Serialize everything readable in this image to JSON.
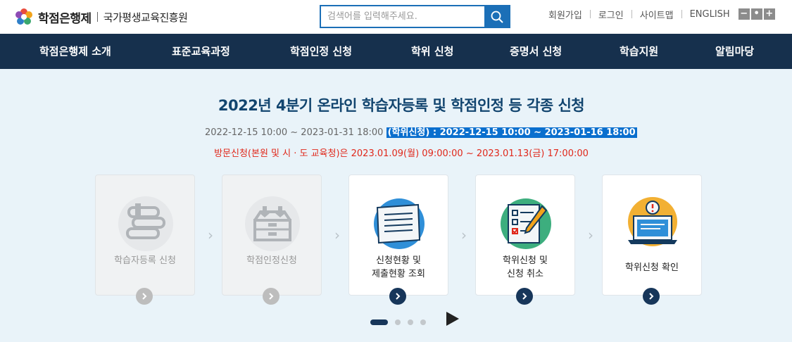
{
  "header": {
    "logo_name": "학점은행제",
    "org_name": "국가평생교육진흥원",
    "search_placeholder": "검색어를 입력해주세요.",
    "util_links": [
      "회원가입",
      "로그인",
      "사이트맵",
      "ENGLISH"
    ],
    "font_controls": [
      "−",
      "•",
      "+"
    ]
  },
  "nav": {
    "items": [
      "학점은행제 소개",
      "표준교육과정",
      "학점인정 신청",
      "학위 신청",
      "증명서 신청",
      "학습지원",
      "알림마당"
    ]
  },
  "notice": {
    "headline": "2022년 4분기 온라인 학습자등록 및 학점인정 등 각종 신청",
    "period": "2022-12-15 10:00 ~ 2023-01-31 18:00 ",
    "period_highlight": "(학위신청) : 2022-12-15 10:00 ~ 2023-01-16 18:00",
    "visit": "방문신청(본원 및 시 · 도 교육청)은 2023.01.09(월) 09:00:00 ~ 2023.01.13(금) 17:00:00"
  },
  "steps": [
    {
      "line1": "학습자등록 신청",
      "line2": "",
      "state": "disabled"
    },
    {
      "line1": "학점인정신청",
      "line2": "",
      "state": "disabled"
    },
    {
      "line1": "신청현황 및",
      "line2": "제출현황 조회",
      "state": "active"
    },
    {
      "line1": "학위신청 및",
      "line2": "신청 취소",
      "state": "active"
    },
    {
      "line1": "학위신청 확인",
      "line2": "",
      "state": "active"
    }
  ],
  "colors": {
    "nav_bg": "#16304d",
    "accent": "#1b6fb7",
    "headline": "#12456f",
    "visit_text": "#e0281b",
    "highlight_bg": "#0a6fce",
    "page_bg": "#e9f3f9"
  },
  "carousel": {
    "pages": 4,
    "active": 1
  }
}
